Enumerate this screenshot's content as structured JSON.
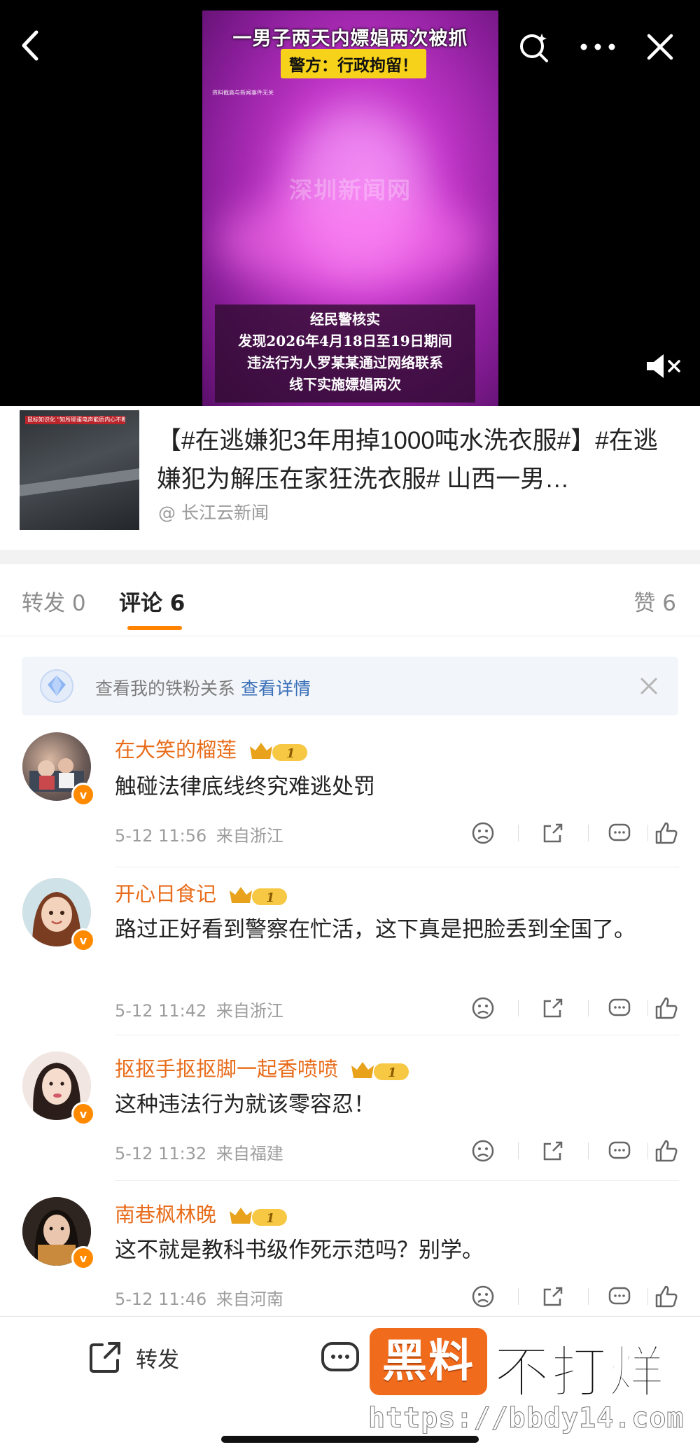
{
  "video": {
    "headline": "一男子两天内嫖娼两次被抓",
    "badge": "警方：行政拘留！",
    "source_note": "资料截高与新闻事件无关",
    "watermark": "深圳新闻网",
    "caption_lines": [
      "经民警核实",
      "发现2026年4月18日至19日期间",
      "违法行为人罗某某通过网络联系",
      "线下实施嫖娼两次"
    ],
    "muted": true
  },
  "post": {
    "title": "【#在逃嫌犯3年用掉1000吨水洗衣服#】#在逃嫌犯为解压在家狂洗衣服# 山西一男…",
    "author": "@ 长江云新闻",
    "thumb_banner": "鼠标知识化 \"知所耶蛋电声能质内心不断\""
  },
  "tabs": {
    "repost": "转发 0",
    "comment": "评论 6",
    "like": "赞 6"
  },
  "fans_banner": {
    "text": "查看我的铁粉关系",
    "link": "查看详情"
  },
  "comments": [
    {
      "name": "在大笑的榴莲",
      "text": "触碰法律底线终究难逃处罚",
      "time": "5-12 11:56",
      "location": "来自浙江",
      "level": "1"
    },
    {
      "name": "开心日食记",
      "text": "路过正好看到警察在忙活，这下真是把脸丢到全国了。",
      "time": "5-12 11:42",
      "location": "来自浙江",
      "level": "1"
    },
    {
      "name": "抠抠手抠抠脚一起香喷喷",
      "text": "这种违法行为就该零容忍！",
      "time": "5-12 11:32",
      "location": "来自福建",
      "level": "1"
    },
    {
      "name": "南巷枫林晚",
      "text": "这不就是教科书级作死示范吗？别学。",
      "time": "5-12 11:46",
      "location": "来自河南",
      "level": "1"
    }
  ],
  "bottom": {
    "repost": "转发",
    "comment": "评论"
  },
  "watermark": {
    "brand_box": "黑料",
    "brand_rest": "不打烊",
    "url": "https://bbdy14.com"
  },
  "colors": {
    "accent": "#ff8200",
    "username": "#e86c1a",
    "link": "#3a70b8"
  }
}
